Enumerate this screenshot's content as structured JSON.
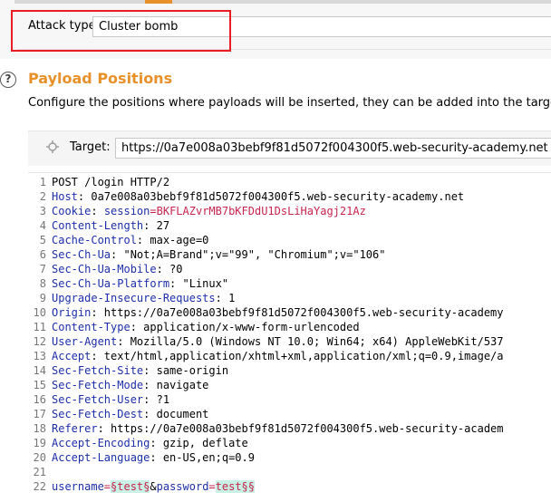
{
  "attack": {
    "label": "Attack type:",
    "selected": "Cluster bomb"
  },
  "payload_positions": {
    "help_icon_text": "?",
    "title": "Payload Positions",
    "description": "Configure the positions where payloads will be inserted, they can be added into the target as well as t"
  },
  "target": {
    "label": "Target:",
    "value": "https://0a7e008a03bebf9f81d5072f004300f5.web-security-academy.net"
  },
  "request_lines": [
    {
      "n": "1",
      "parts": [
        {
          "t": "POST /login HTTP/2",
          "c": "plain"
        }
      ]
    },
    {
      "n": "2",
      "parts": [
        {
          "t": "Host",
          "c": "hdr-name"
        },
        {
          "t": ": 0a7e008a03bebf9f81d5072f004300f5.web-security-academy.net",
          "c": "plain"
        }
      ]
    },
    {
      "n": "3",
      "parts": [
        {
          "t": "Cookie",
          "c": "hdr-name"
        },
        {
          "t": ": ",
          "c": "plain"
        },
        {
          "t": "session",
          "c": "hdr-name"
        },
        {
          "t": "=BKFLAZvrMB7bKFDdU1DsLiHaYagj21Az",
          "c": "cookie-val"
        }
      ]
    },
    {
      "n": "4",
      "parts": [
        {
          "t": "Content-Length",
          "c": "hdr-name"
        },
        {
          "t": ": 27",
          "c": "plain"
        }
      ]
    },
    {
      "n": "5",
      "parts": [
        {
          "t": "Cache-Control",
          "c": "hdr-name"
        },
        {
          "t": ": max-age=0",
          "c": "plain"
        }
      ]
    },
    {
      "n": "6",
      "parts": [
        {
          "t": "Sec-Ch-Ua",
          "c": "hdr-name"
        },
        {
          "t": ": \"Not;A=Brand\";v=\"99\", \"Chromium\";v=\"106\"",
          "c": "plain"
        }
      ]
    },
    {
      "n": "7",
      "parts": [
        {
          "t": "Sec-Ch-Ua-Mobile",
          "c": "hdr-name"
        },
        {
          "t": ": ?0",
          "c": "plain"
        }
      ]
    },
    {
      "n": "8",
      "parts": [
        {
          "t": "Sec-Ch-Ua-Platform",
          "c": "hdr-name"
        },
        {
          "t": ": \"Linux\"",
          "c": "plain"
        }
      ]
    },
    {
      "n": "9",
      "parts": [
        {
          "t": "Upgrade-Insecure-Requests",
          "c": "hdr-name"
        },
        {
          "t": ": 1",
          "c": "plain"
        }
      ]
    },
    {
      "n": "10",
      "parts": [
        {
          "t": "Origin",
          "c": "hdr-name"
        },
        {
          "t": ": https://0a7e008a03bebf9f81d5072f004300f5.web-security-academy",
          "c": "plain"
        }
      ]
    },
    {
      "n": "11",
      "parts": [
        {
          "t": "Content-Type",
          "c": "hdr-name"
        },
        {
          "t": ": application/x-www-form-urlencoded",
          "c": "plain"
        }
      ]
    },
    {
      "n": "12",
      "parts": [
        {
          "t": "User-Agent",
          "c": "hdr-name"
        },
        {
          "t": ": Mozilla/5.0 (Windows NT 10.0; Win64; x64) AppleWebKit/537",
          "c": "plain"
        }
      ]
    },
    {
      "n": "13",
      "parts": [
        {
          "t": "Accept",
          "c": "hdr-name"
        },
        {
          "t": ": text/html,application/xhtml+xml,application/xml;q=0.9,image/a",
          "c": "plain"
        }
      ]
    },
    {
      "n": "14",
      "parts": [
        {
          "t": "Sec-Fetch-Site",
          "c": "hdr-name"
        },
        {
          "t": ": same-origin",
          "c": "plain"
        }
      ]
    },
    {
      "n": "15",
      "parts": [
        {
          "t": "Sec-Fetch-Mode",
          "c": "hdr-name"
        },
        {
          "t": ": navigate",
          "c": "plain"
        }
      ]
    },
    {
      "n": "16",
      "parts": [
        {
          "t": "Sec-Fetch-User",
          "c": "hdr-name"
        },
        {
          "t": ": ?1",
          "c": "plain"
        }
      ]
    },
    {
      "n": "17",
      "parts": [
        {
          "t": "Sec-Fetch-Dest",
          "c": "hdr-name"
        },
        {
          "t": ": document",
          "c": "plain"
        }
      ]
    },
    {
      "n": "18",
      "parts": [
        {
          "t": "Referer",
          "c": "hdr-name"
        },
        {
          "t": ": https://0a7e008a03bebf9f81d5072f004300f5.web-security-academ",
          "c": "plain"
        }
      ]
    },
    {
      "n": "19",
      "parts": [
        {
          "t": "Accept-Encoding",
          "c": "hdr-name"
        },
        {
          "t": ": gzip, deflate",
          "c": "plain"
        }
      ]
    },
    {
      "n": "20",
      "parts": [
        {
          "t": "Accept-Language",
          "c": "hdr-name"
        },
        {
          "t": ": en-US,en;q=0.9",
          "c": "plain"
        }
      ]
    },
    {
      "n": "21",
      "parts": []
    },
    {
      "n": "22",
      "parts": [
        {
          "t": "username",
          "c": "param-name"
        },
        {
          "t": "=",
          "c": "param-eq"
        },
        {
          "t": "§test§",
          "c": "payload-pos"
        },
        {
          "t": "&",
          "c": "plain"
        },
        {
          "t": "password",
          "c": "param-name"
        },
        {
          "t": "=",
          "c": "param-eq"
        },
        {
          "t": "test§§",
          "c": "payload-pos"
        }
      ]
    }
  ],
  "colors": {
    "accent": "#e8912b",
    "highlight_box": "#ec1c24",
    "header_name": "#1c2fa8",
    "cookie_value": "#c7254e",
    "payload_marker_bg": "#c9f1e6"
  },
  "icons": {
    "help": "help-circle-icon",
    "target": "crosshair-icon"
  }
}
